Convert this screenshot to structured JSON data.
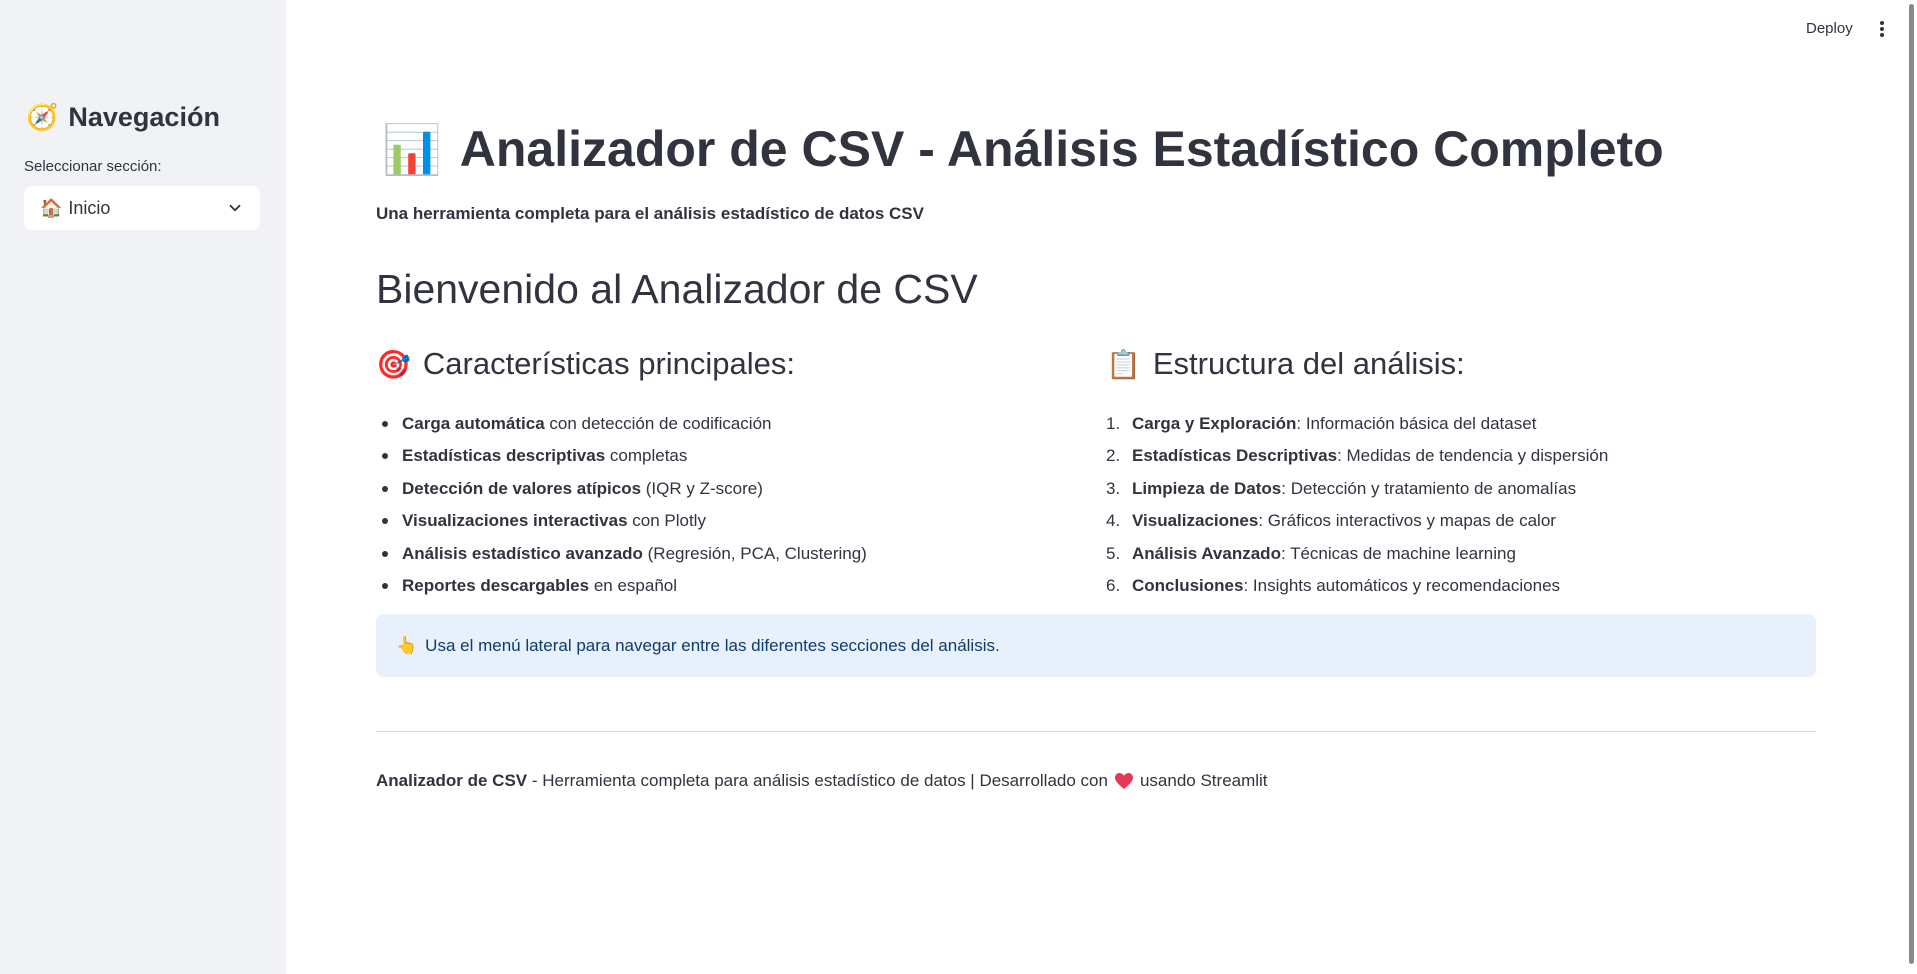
{
  "header": {
    "deploy_label": "Deploy"
  },
  "sidebar": {
    "title": "Navegación",
    "title_icon": "🧭",
    "select_label": "Seleccionar sección:",
    "select_icon": "🏠",
    "select_value": "Inicio"
  },
  "main": {
    "title_icon": "📊",
    "title": "Analizador de CSV - Análisis Estadístico Completo",
    "subtitle": "Una herramienta completa para el análisis estadístico de datos CSV",
    "welcome": "Bienvenido al Analizador de CSV",
    "features": {
      "icon": "🎯",
      "heading": "Características principales:",
      "items": [
        {
          "bold": "Carga automática",
          "rest": " con detección de codificación"
        },
        {
          "bold": "Estadísticas descriptivas",
          "rest": " completas"
        },
        {
          "bold": "Detección de valores atípicos",
          "rest": " (IQR y Z-score)"
        },
        {
          "bold": "Visualizaciones interactivas",
          "rest": " con Plotly"
        },
        {
          "bold": "Análisis estadístico avanzado",
          "rest": " (Regresión, PCA, Clustering)"
        },
        {
          "bold": "Reportes descargables",
          "rest": " en español"
        }
      ]
    },
    "structure": {
      "icon": "📋",
      "heading": "Estructura del análisis:",
      "items": [
        {
          "num": "1.",
          "bold": "Carga y Exploración",
          "rest": ": Información básica del dataset"
        },
        {
          "num": "2.",
          "bold": "Estadísticas Descriptivas",
          "rest": ": Medidas de tendencia y dispersión"
        },
        {
          "num": "3.",
          "bold": "Limpieza de Datos",
          "rest": ": Detección y tratamiento de anomalías"
        },
        {
          "num": "4.",
          "bold": "Visualizaciones",
          "rest": ": Gráficos interactivos y mapas de calor"
        },
        {
          "num": "5.",
          "bold": "Análisis Avanzado",
          "rest": ": Técnicas de machine learning"
        },
        {
          "num": "6.",
          "bold": "Conclusiones",
          "rest": ": Insights automáticos y recomendaciones"
        }
      ]
    },
    "info": {
      "icon": "👆",
      "text": "Usa el menú lateral para navegar entre las diferentes secciones del análisis."
    },
    "footer": {
      "bold": "Analizador de CSV",
      "text_before": " - Herramienta completa para análisis estadístico de datos | Desarrollado con",
      "text_after": "usando Streamlit"
    }
  },
  "colors": {
    "sidebar_bg": "#f0f2f6",
    "info_bg": "#e8f0fb",
    "info_text": "#0d3c6b",
    "heart": "#e8385a"
  }
}
